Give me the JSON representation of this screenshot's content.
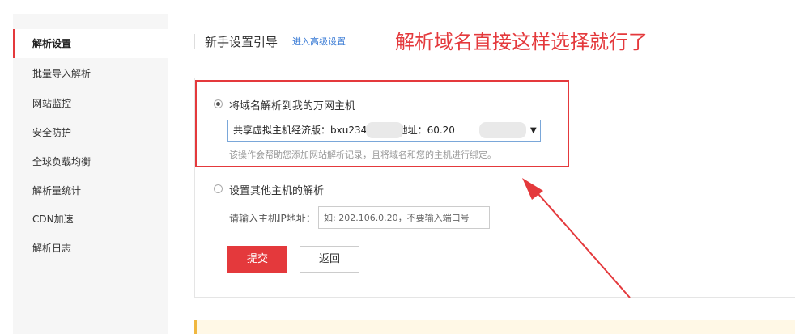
{
  "sidebar": {
    "items": [
      {
        "label": "解析设置",
        "active": true
      },
      {
        "label": "批量导入解析"
      },
      {
        "label": "网站监控"
      },
      {
        "label": "安全防护"
      },
      {
        "label": "全球负载均衡"
      },
      {
        "label": "解析量统计"
      },
      {
        "label": "CDN加速"
      },
      {
        "label": "解析日志"
      }
    ]
  },
  "header": {
    "title": "新手设置引导",
    "advanced_link": "进入高级设置"
  },
  "annotation": {
    "text": "解析域名直接这样选择就行了",
    "color": "#e4393c"
  },
  "option_own_host": {
    "label": "将域名解析到我的万网主机",
    "selected": true,
    "select_value": "共享虚拟主机经济版：bxu23409        ( IP地址：60.20",
    "hint": "该操作会帮助您添加网站解析记录，且将域名和您的主机进行绑定。"
  },
  "option_other_host": {
    "label": "设置其他主机的解析",
    "selected": false,
    "ip_label": "请输入主机IP地址：",
    "ip_placeholder": "如: 202.106.0.20，不要输入端口号"
  },
  "buttons": {
    "submit": "提交",
    "back": "返回"
  },
  "colors": {
    "accent": "#e4393c",
    "link": "#3a7bd5"
  }
}
